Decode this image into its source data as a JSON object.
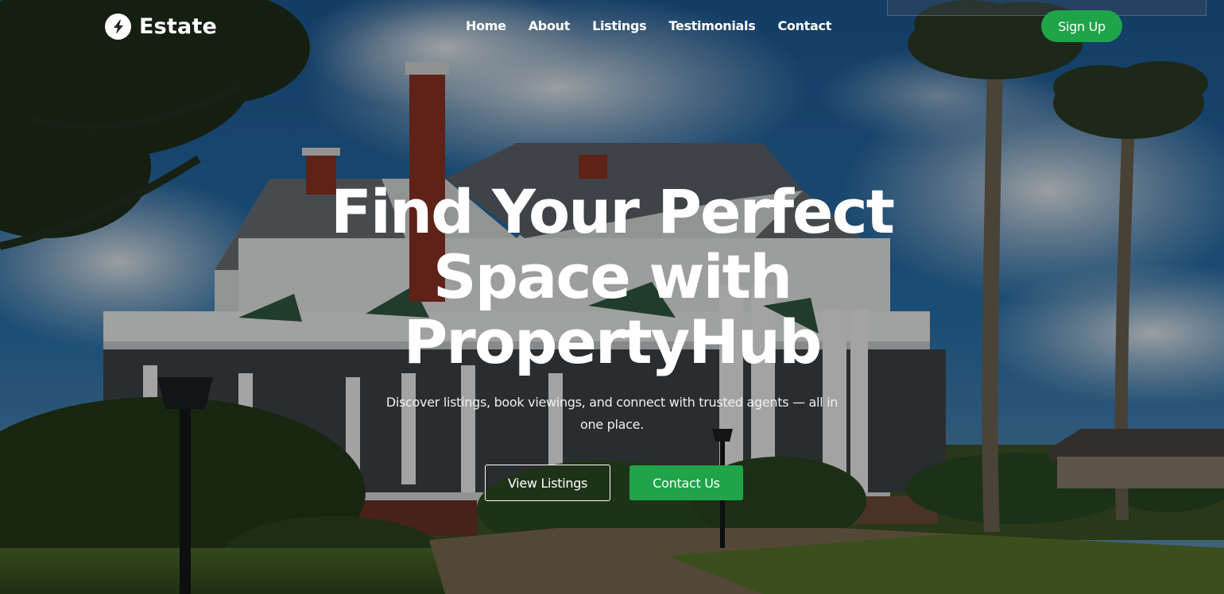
{
  "brand": {
    "name": "Estate",
    "icon": "bolt-icon"
  },
  "nav": {
    "links": [
      "Home",
      "About",
      "Listings",
      "Testimonials",
      "Contact"
    ],
    "signup_label": "Sign Up"
  },
  "hero": {
    "headline_line1": "Find Your Perfect",
    "headline_line2": "Space with",
    "headline_line3": "PropertyHub",
    "subtext": "Discover listings, book viewings, and connect with trusted agents — all in one place.",
    "primary_cta": "View Listings",
    "secondary_cta": "Contact Us"
  },
  "colors": {
    "accent": "#1fa44a",
    "text": "#ffffff",
    "overlay": "rgba(0,0,0,0.32)"
  }
}
